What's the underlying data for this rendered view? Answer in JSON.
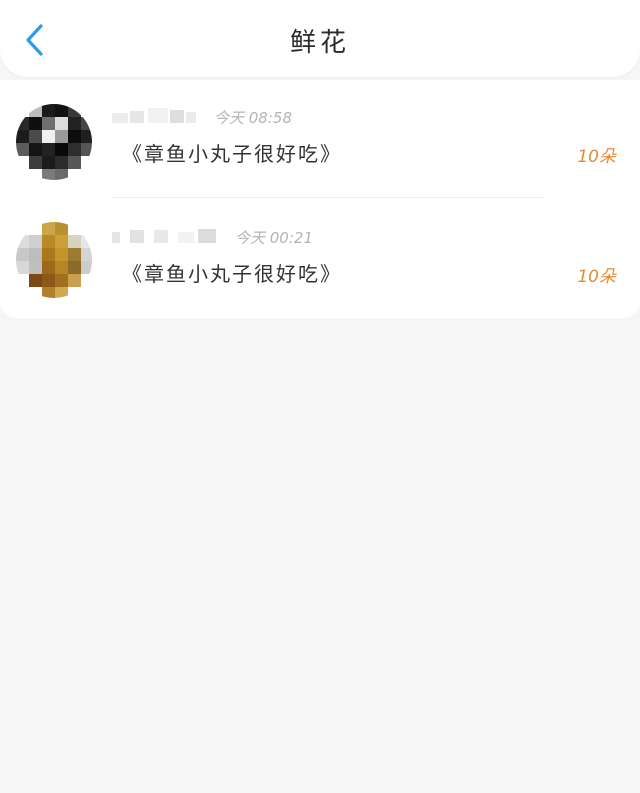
{
  "header": {
    "title": "鲜花",
    "back_icon": "chevron-left-icon",
    "accent_color": "#2d9be9"
  },
  "gifts": [
    {
      "avatar": "pixelated-avatar-dark",
      "time": "今天 08:58",
      "message": "《章鱼小丸子很好吃》",
      "count": "10朵"
    },
    {
      "avatar": "pixelated-avatar-gold",
      "time": "今天 00:21",
      "message": "《章鱼小丸子很好吃》",
      "count": "10朵"
    }
  ],
  "colors": {
    "count": "#e58a34",
    "time": "#b4b4b4",
    "background": "#f7f6f7"
  }
}
